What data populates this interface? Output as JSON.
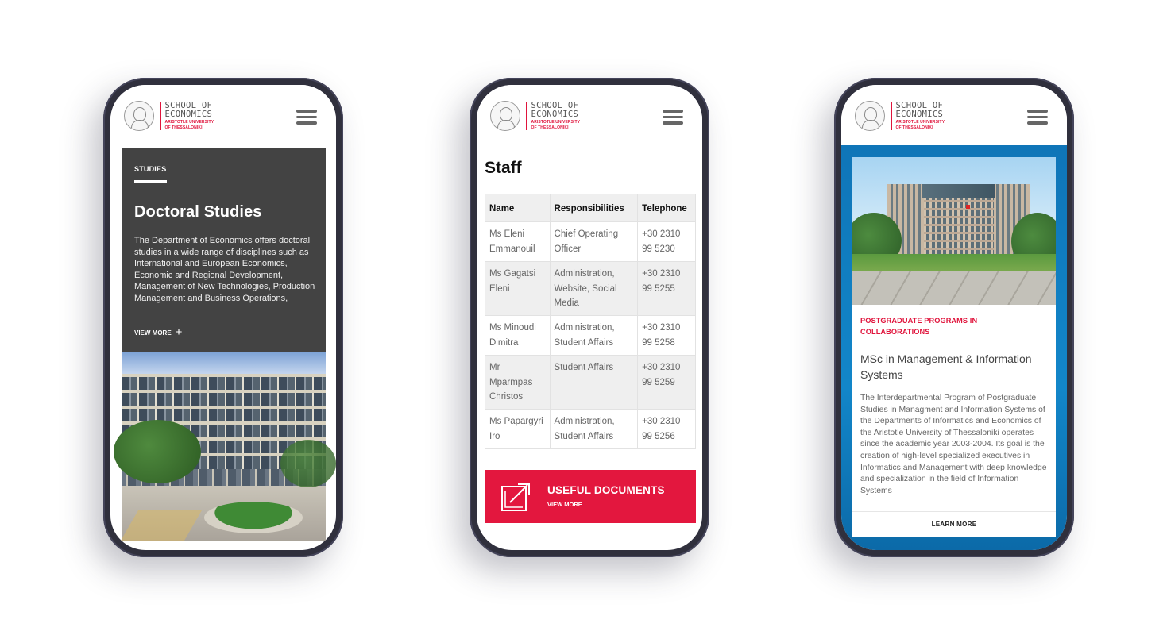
{
  "brand": {
    "school_name_line1": "SCHOOL OF",
    "school_name_line2": "ECONOMICS",
    "university_line1": "ARISTOTLE UNIVERSITY",
    "university_line2": "OF THESSALONIKI",
    "accent_color": "#e3173e",
    "icons": {
      "seal": "university-seal-icon",
      "menu": "hamburger-menu-icon"
    }
  },
  "phones": [
    {
      "screen": "doctoral-studies",
      "card": {
        "eyebrow": "STUDIES",
        "title": "Doctoral Studies",
        "body": "The Department of Economics offers doctoral studies in a wide range of disciplines such as International and European Economics, Economic and Regional Development, Management of New Technologies, Production Management and Business Operations,",
        "view_more": "VIEW MORE",
        "view_more_icon": "plus-icon"
      },
      "image": "campus-building-photo"
    },
    {
      "screen": "staff",
      "title": "Staff",
      "table": {
        "headers": [
          "Name",
          "Responsibilities",
          "Telephone"
        ],
        "rows": [
          {
            "name": "Ms Eleni Emmanouil",
            "responsibilities": "Chief Operating Officer",
            "telephone": "+30 2310 99 5230"
          },
          {
            "name": "Ms Gagatsi Eleni",
            "responsibilities": "Administration, Website, Social Media",
            "telephone": "+30 2310 99 5255"
          },
          {
            "name": "Ms Minoudi Dimitra",
            "responsibilities": "Administration, Student Affairs",
            "telephone": "+30 2310 99 5258"
          },
          {
            "name": "Mr Mparmpas Christos",
            "responsibilities": "Student Affairs",
            "telephone": "+30 2310 99 5259"
          },
          {
            "name": "Ms Papargyri Iro",
            "responsibilities": "Administration, Student Affairs",
            "telephone": "+30 2310 99 5256"
          }
        ]
      },
      "useful_documents": {
        "title": "USEFUL DOCUMENTS",
        "subtitle": "VIEW MORE",
        "icon": "external-link-icon"
      }
    },
    {
      "screen": "postgraduate-program",
      "card": {
        "eyebrow": "POSTGRADUATE PROGRAMS IN COLLABORATIONS",
        "title": "MSc in Management & Information Systems",
        "body": "The Interdepartmental Program of Postgraduate Studies in Managment and Information Systems of the Departments of Informatics and Economics of the Aristotle University of Thessaloniki operates since the academic year 2003-2004. Its goal is the creation of high-level specialized executives in Informatics and Management with deep knowledge and specialization in the field of Information Systems",
        "cta": "LEARN MORE"
      },
      "image": "university-main-building-photo"
    }
  ]
}
